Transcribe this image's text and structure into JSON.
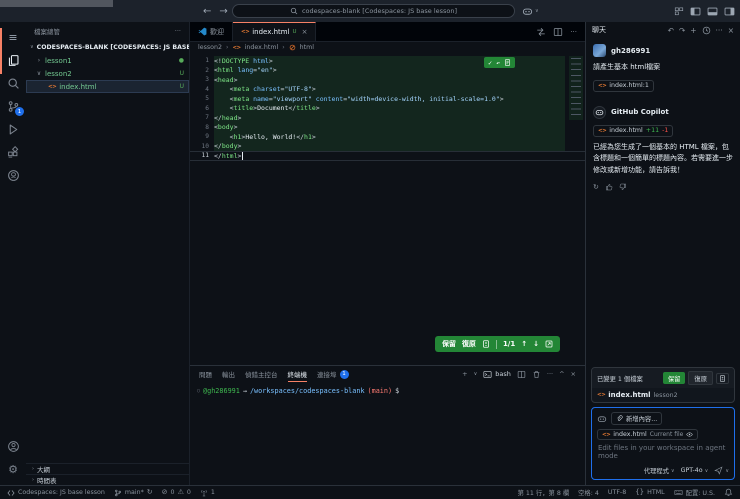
{
  "titlebar": {
    "search_text": "codespaces-blank [Codespaces: JS base lesson]"
  },
  "icons": {
    "back": "←",
    "forward": "→",
    "menu": "≡",
    "more": "···",
    "close": "×",
    "check": "✓",
    "undo_arrow": "↶",
    "redo_arrow": "↷",
    "refresh": "↻",
    "up": "↑",
    "down": "↓",
    "plus": "+",
    "chevron_right": "›",
    "chevron_expanded": "∨",
    "chevron_collapsed": "›",
    "chevron_down": "∨",
    "chevron_up": "^",
    "dot": "●",
    "circle": "○",
    "braces": "{}",
    "error": "⊘",
    "warning": "⚠",
    "gear": "⚙",
    "html_tag": "<>"
  },
  "activity_bar": {
    "scm_badge": "1"
  },
  "explorer": {
    "title": "檔案總管",
    "root_label": "CODESPACES-BLANK [CODESPACES: JS BASE ...",
    "items": [
      {
        "label": "lesson1",
        "badge": "●"
      },
      {
        "label": "lesson2",
        "badge": "U"
      },
      {
        "label": "index.html",
        "badge": "U"
      }
    ],
    "outline_label": "大綱",
    "timeline_label": "時間表"
  },
  "editor": {
    "tabs": [
      {
        "label": "歡迎"
      },
      {
        "label": "index.html",
        "badge": "U"
      }
    ],
    "breadcrumb": {
      "folder": "lesson2",
      "file": "index.html",
      "symbol": "html"
    },
    "inline_actions": {
      "keep": "保留",
      "undo": "復原",
      "counter": "1/1"
    },
    "lines": [
      {
        "num": 1,
        "added": true,
        "segs": [
          [
            "pun",
            "<!"
          ],
          [
            "tag",
            "DOCTYPE"
          ],
          [
            "attr",
            " html"
          ],
          [
            "pun",
            ">"
          ]
        ]
      },
      {
        "num": 2,
        "added": true,
        "segs": [
          [
            "pun",
            "<"
          ],
          [
            "tag",
            "html"
          ],
          [
            "attr",
            " lang"
          ],
          [
            "pun",
            "="
          ],
          [
            "str",
            "\"en\""
          ],
          [
            "pun",
            ">"
          ]
        ]
      },
      {
        "num": 3,
        "added": true,
        "segs": [
          [
            "pun",
            "<"
          ],
          [
            "tag",
            "head"
          ],
          [
            "pun",
            ">"
          ]
        ]
      },
      {
        "num": 4,
        "added": true,
        "segs": [
          [
            "pun",
            "    <"
          ],
          [
            "tag",
            "meta"
          ],
          [
            "attr",
            " charset"
          ],
          [
            "pun",
            "="
          ],
          [
            "str",
            "\"UTF-8\""
          ],
          [
            "pun",
            ">"
          ]
        ]
      },
      {
        "num": 5,
        "added": true,
        "segs": [
          [
            "pun",
            "    <"
          ],
          [
            "tag",
            "meta"
          ],
          [
            "attr",
            " name"
          ],
          [
            "pun",
            "="
          ],
          [
            "str",
            "\"viewport\""
          ],
          [
            "attr",
            " content"
          ],
          [
            "pun",
            "="
          ],
          [
            "str",
            "\"width=device-width, initial-scale=1.0\""
          ],
          [
            "pun",
            ">"
          ]
        ]
      },
      {
        "num": 6,
        "added": true,
        "segs": [
          [
            "pun",
            "    <"
          ],
          [
            "tag",
            "title"
          ],
          [
            "pun",
            ">"
          ],
          [
            "txt",
            "Document"
          ],
          [
            "pun",
            "</"
          ],
          [
            "tag",
            "title"
          ],
          [
            "pun",
            ">"
          ]
        ]
      },
      {
        "num": 7,
        "added": true,
        "segs": [
          [
            "pun",
            "</"
          ],
          [
            "tag",
            "head"
          ],
          [
            "pun",
            ">"
          ]
        ]
      },
      {
        "num": 8,
        "added": true,
        "segs": [
          [
            "pun",
            "<"
          ],
          [
            "tag",
            "body"
          ],
          [
            "pun",
            ">"
          ]
        ]
      },
      {
        "num": 9,
        "added": true,
        "segs": [
          [
            "pun",
            "    <"
          ],
          [
            "tag",
            "h1"
          ],
          [
            "pun",
            ">"
          ],
          [
            "txt",
            "Hello, World!"
          ],
          [
            "pun",
            "</"
          ],
          [
            "tag",
            "h1"
          ],
          [
            "pun",
            ">"
          ]
        ]
      },
      {
        "num": 10,
        "added": true,
        "segs": [
          [
            "pun",
            "</"
          ],
          [
            "tag",
            "body"
          ],
          [
            "pun",
            ">"
          ]
        ]
      },
      {
        "num": 11,
        "added": false,
        "current": true,
        "segs": [
          [
            "pun",
            "</"
          ],
          [
            "tag",
            "html"
          ],
          [
            "pun",
            ">"
          ]
        ]
      }
    ]
  },
  "panel": {
    "tabs": [
      {
        "label": "問題"
      },
      {
        "label": "輸出"
      },
      {
        "label": "偵錯主控台"
      },
      {
        "label": "終端機"
      },
      {
        "label": "連接埠",
        "badge": "1"
      }
    ],
    "shell_label": "bash",
    "terminal": {
      "user": "@gh286991",
      "arrow": "→",
      "path": "/workspaces/codespaces-blank",
      "branch": "(main)",
      "prompt": "$"
    }
  },
  "chat": {
    "title": "聊天",
    "user_name": "gh286991",
    "user_message": "請產生基本 html檔案",
    "user_attachment": "index.html:1",
    "assistant_name": "GitHub Copilot",
    "assistant_file": "index.html",
    "added": "+11",
    "removed": "-1",
    "assistant_message": "已經為您生成了一個基本的 HTML 檔案，包含標題和一個簡單的標題內容。若需要進一步修改或新增功能，請告訴我！",
    "edits_summary": "已變更 1 個檔案",
    "keep_label": "保留",
    "undo_label": "復原",
    "edited_file": "index.html",
    "edited_file_path": "lesson2",
    "add_context_label": "新增內容...",
    "context_chip_file": "index.html",
    "context_chip_suffix": "Current file",
    "input_placeholder": "Edit files in your workspace in agent mode",
    "mode_label": "代理程式",
    "model_label": "GPT-4o"
  },
  "status_bar": {
    "remote": "Codespaces: JS base lesson",
    "branch": "main*",
    "errors": "0",
    "warnings": "0",
    "ports": "1",
    "line_col": "第 11 行，第 8 欄",
    "indent": "空格: 4",
    "encoding": "UTF-8",
    "language": "HTML",
    "keyboard_layout": "配置: U.S."
  },
  "colors": {
    "accent_orange": "#f78166",
    "button_green": "#238636",
    "focus_blue": "#1f6feb",
    "added_green": "#3fb950",
    "removed_red": "#f85149",
    "untracked_green": "#73c991",
    "editor_bg": "#0d1117"
  }
}
